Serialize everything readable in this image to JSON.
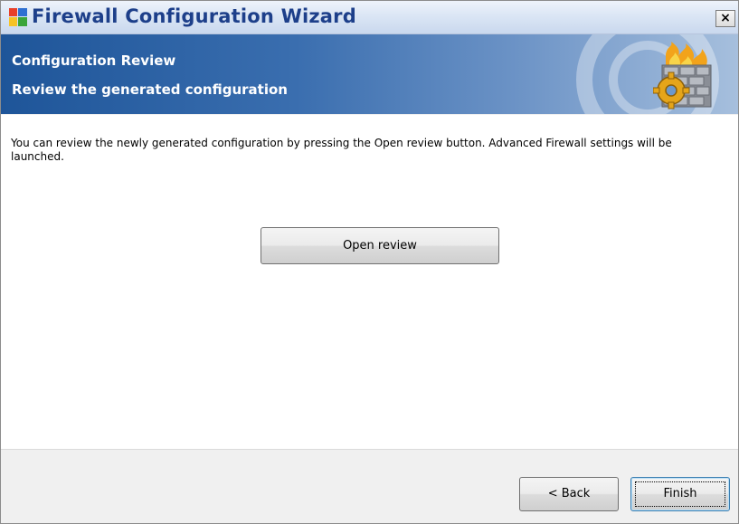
{
  "window": {
    "title": "Firewall Configuration Wizard",
    "close_label": "×"
  },
  "banner": {
    "title": "Configuration Review",
    "subtitle": "Review the generated configuration"
  },
  "content": {
    "description": "You can review the newly generated configuration by pressing the Open review button. Advanced Firewall settings will be launched.",
    "open_review_label": "Open review"
  },
  "footer": {
    "back_label": "< Back",
    "finish_label": "Finish"
  },
  "colors": {
    "title_text": "#1d3f8a",
    "banner_start": "#1e5599",
    "banner_end": "#a6bfdd",
    "content_bg": "#ffffff",
    "footer_bg": "#f0f0f0"
  },
  "icons": {
    "app": "avg-logo-icon",
    "banner": "firewall-wall-gear-icon",
    "close": "close-icon"
  }
}
